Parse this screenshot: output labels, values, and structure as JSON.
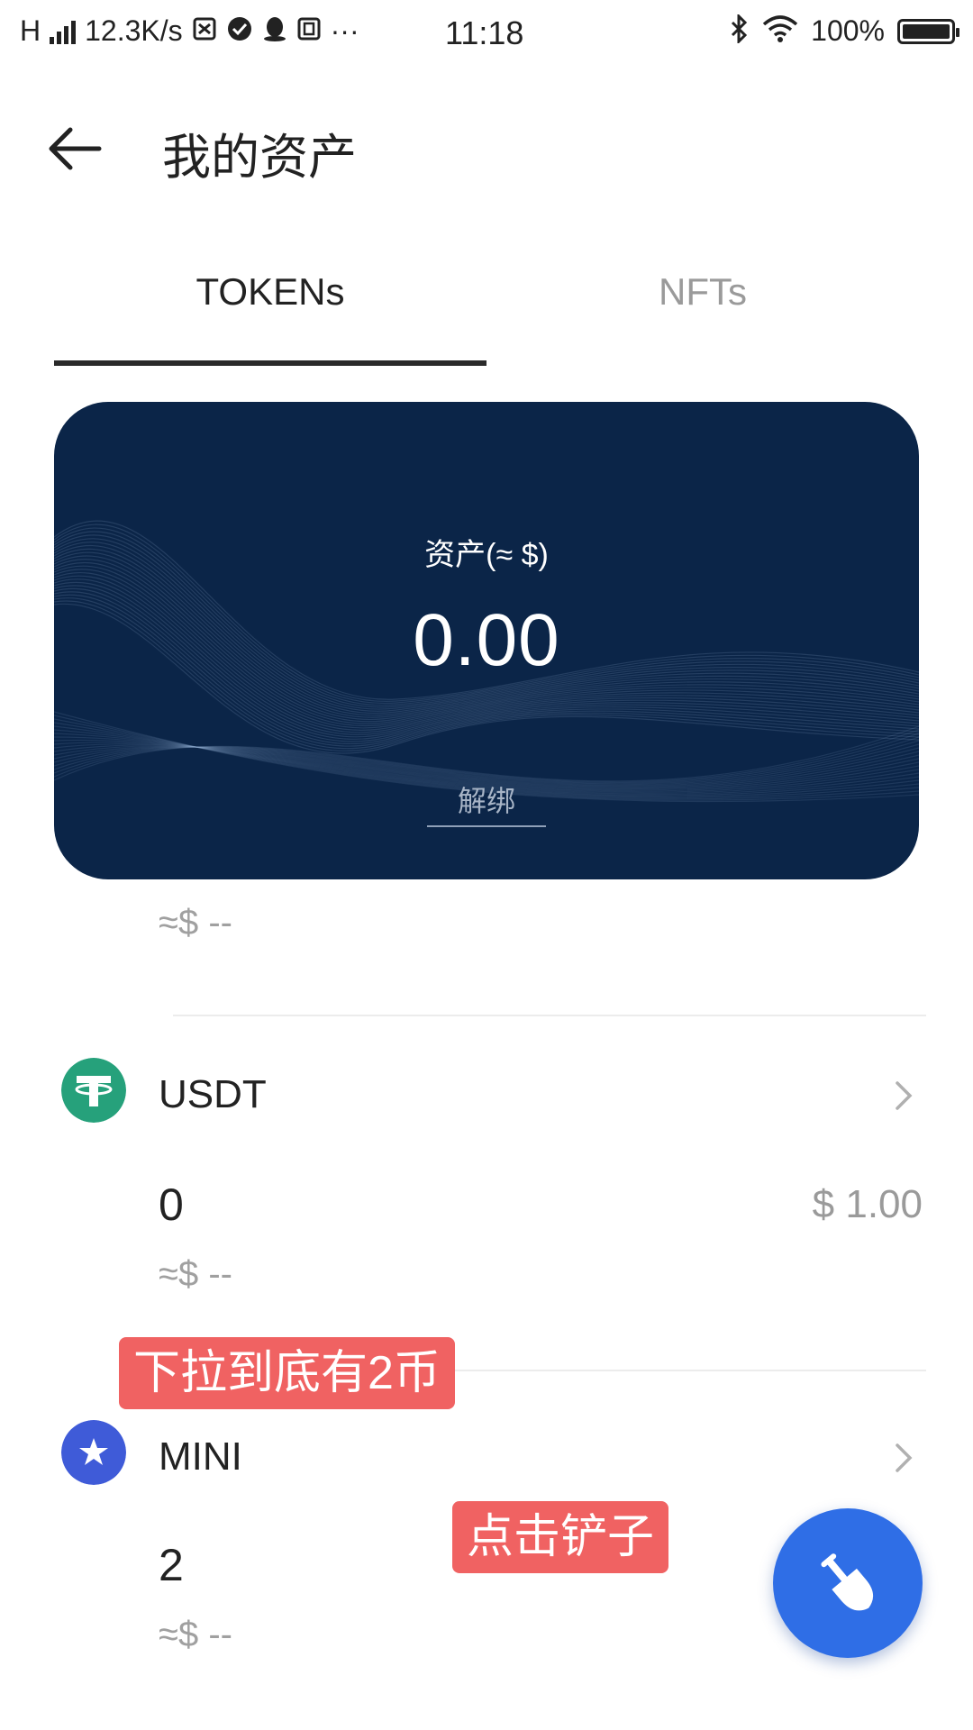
{
  "status_bar": {
    "network": "H",
    "speed": "12.3K/s",
    "more": "···",
    "time": "11:18",
    "battery_text": "100%",
    "battery_level": 1.0
  },
  "header": {
    "title": "我的资产",
    "back_icon": "arrow-left-icon"
  },
  "tabs": [
    {
      "label": "TOKENs",
      "active": true
    },
    {
      "label": "NFTs",
      "active": false
    }
  ],
  "asset_card": {
    "label": "资产(≈ $)",
    "value": "0.00",
    "unbind": "解绑",
    "bg_color": "#0b2548"
  },
  "top_partial": {
    "approx": "≈$ --"
  },
  "tokens": [
    {
      "name": "USDT",
      "icon": "tether-icon",
      "icon_color": "#26a17b",
      "amount": "0",
      "price": "$ 1.00",
      "approx": "≈$ --"
    },
    {
      "name": "MINI",
      "icon": "mini-star-icon",
      "icon_color": "#3f5bd8",
      "amount": "2",
      "price": "",
      "approx": "≈$ --"
    }
  ],
  "annotations": {
    "scroll_note": "下拉到底有2币",
    "click_note": "点击铲子"
  },
  "fab": {
    "icon": "shovel-icon",
    "color": "#2f6ee6"
  }
}
